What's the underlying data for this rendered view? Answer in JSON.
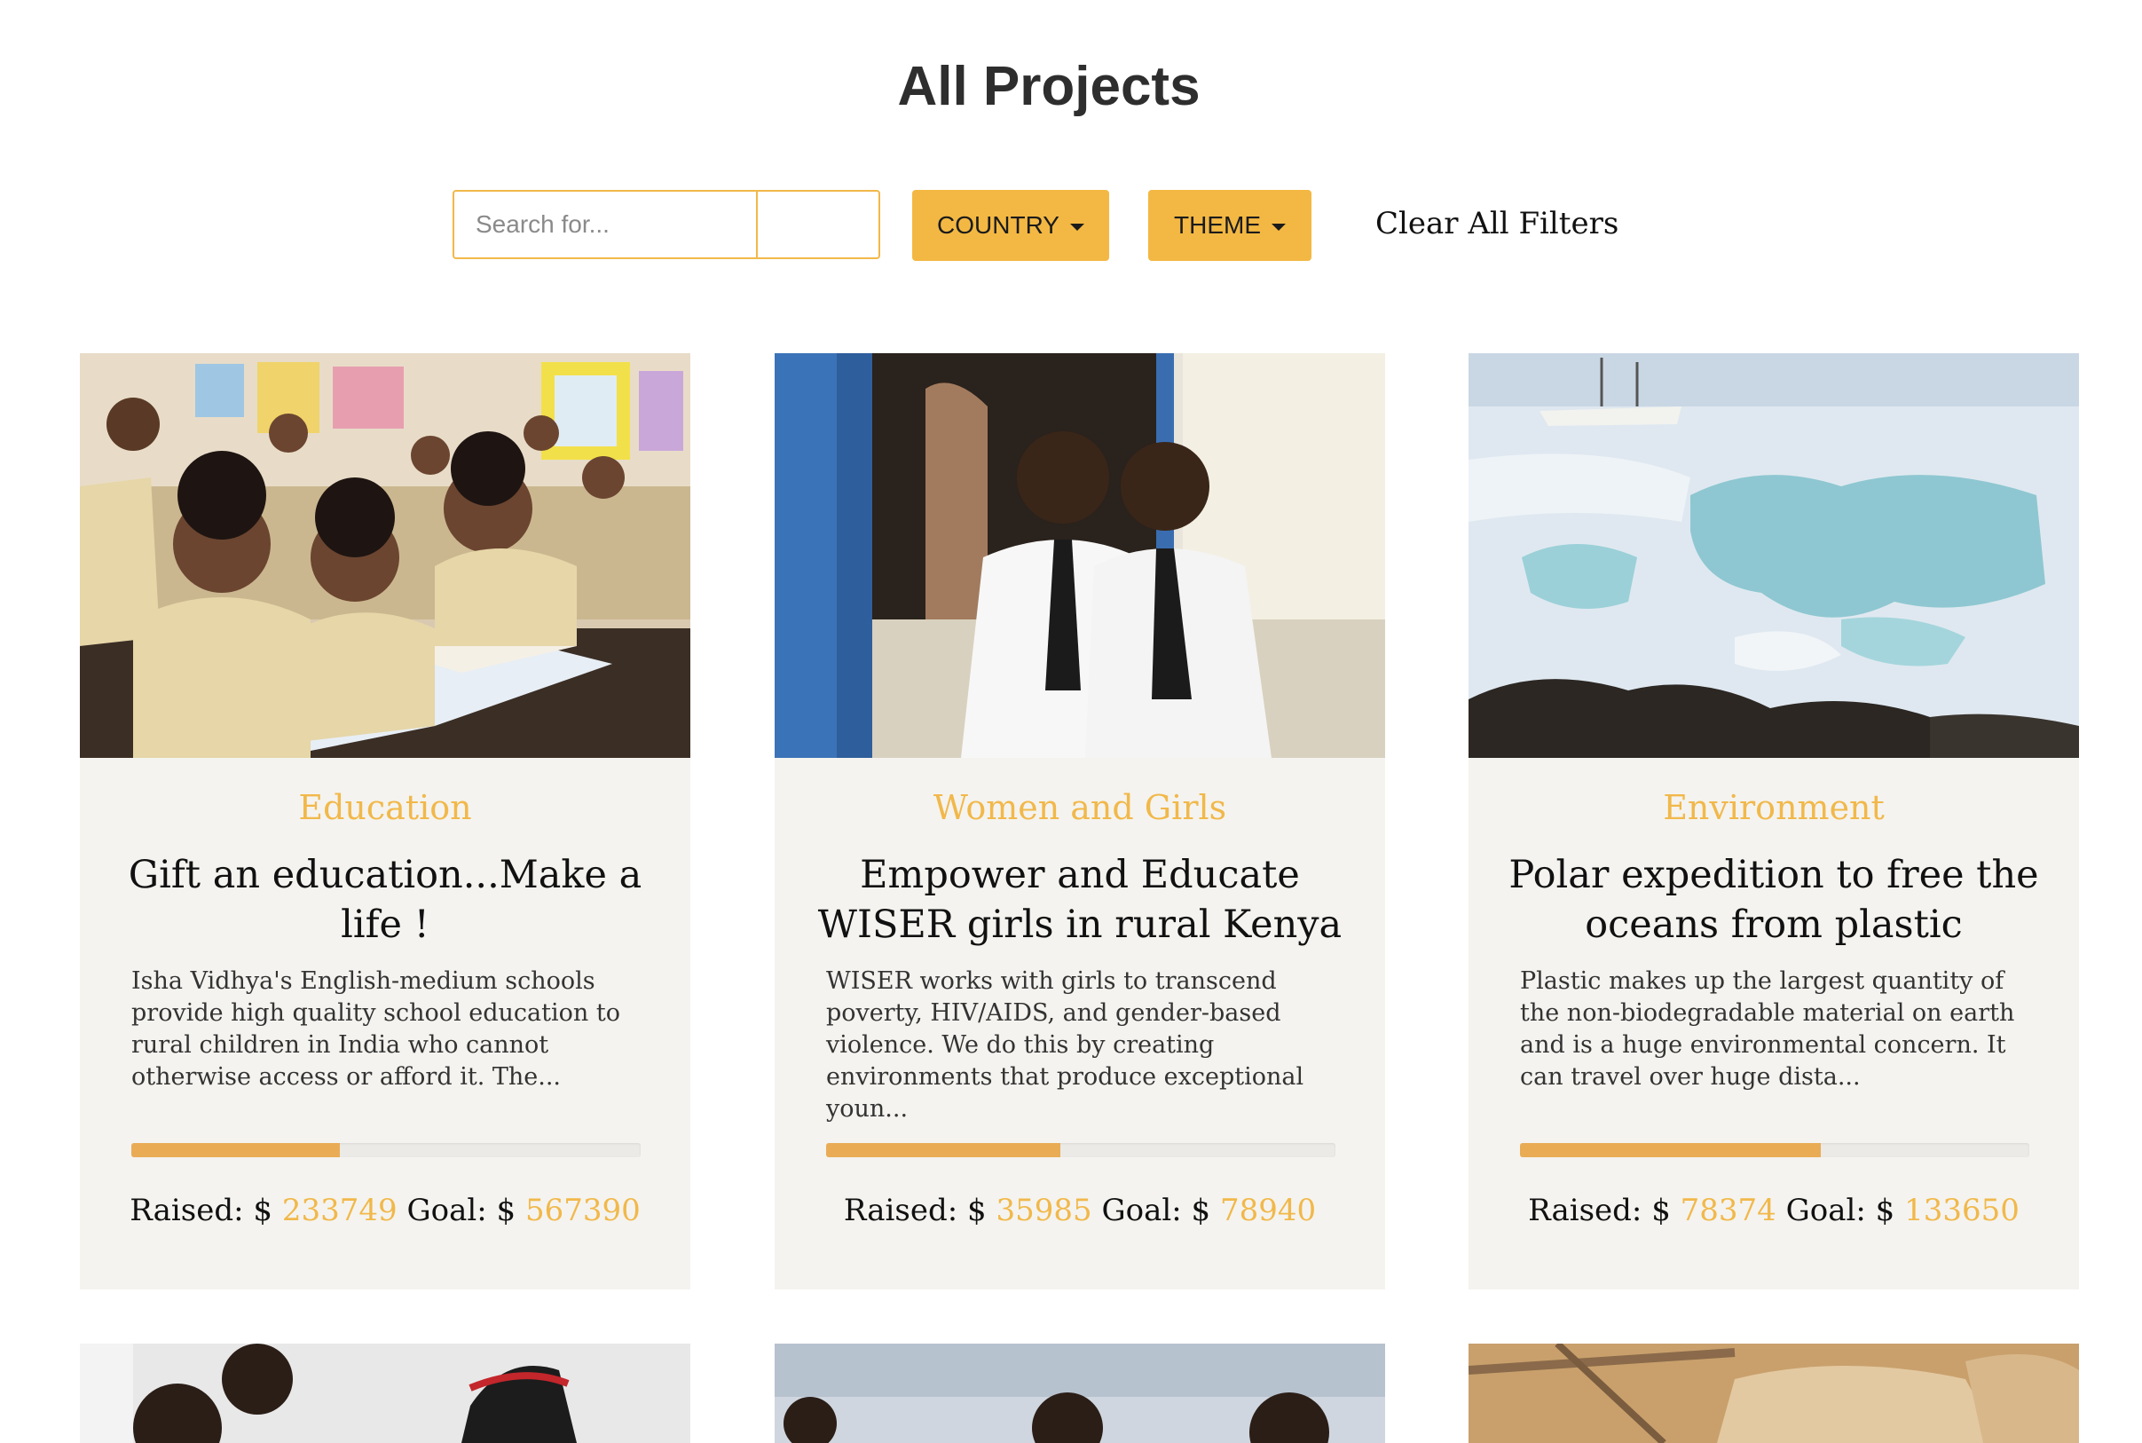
{
  "page": {
    "title": "All Projects"
  },
  "filters": {
    "search_placeholder": "Search for...",
    "country_label": "COUNTRY",
    "theme_label": "THEME",
    "clear_label": "Clear All Filters"
  },
  "labels": {
    "raised": "Raised: $",
    "goal": "Goal: $"
  },
  "colors": {
    "accent": "#f3b843",
    "card_bg": "#f4f3ef",
    "progress": "#e9ac55"
  },
  "projects": [
    {
      "theme": "Education",
      "title": "Gift an education...Make a life !",
      "description": "Isha Vidhya's English-medium schools provide high quality school education to rural children in India who cannot otherwise access or afford it. The...",
      "raised": "233749",
      "goal": "567390",
      "progress": 0.41,
      "image": "classroom children photo"
    },
    {
      "theme": "Women and Girls",
      "title": "Empower and Educate WISER girls in rural Kenya",
      "description": "WISER works with girls to transcend poverty, HIV/AIDS, and gender-based violence. We do this by creating environments that produce exceptional youn...",
      "raised": "35985",
      "goal": "78940",
      "progress": 0.46,
      "image": "two schoolgirls photo"
    },
    {
      "theme": "Environment",
      "title": "Polar expedition to free the oceans from plastic",
      "description": "Plastic makes up the largest quantity of the non-biodegradable material on earth and is a huge environmental concern. It can travel over huge dista...",
      "raised": "78374",
      "goal": "133650",
      "progress": 0.59,
      "image": "polar sea ice photo"
    }
  ]
}
